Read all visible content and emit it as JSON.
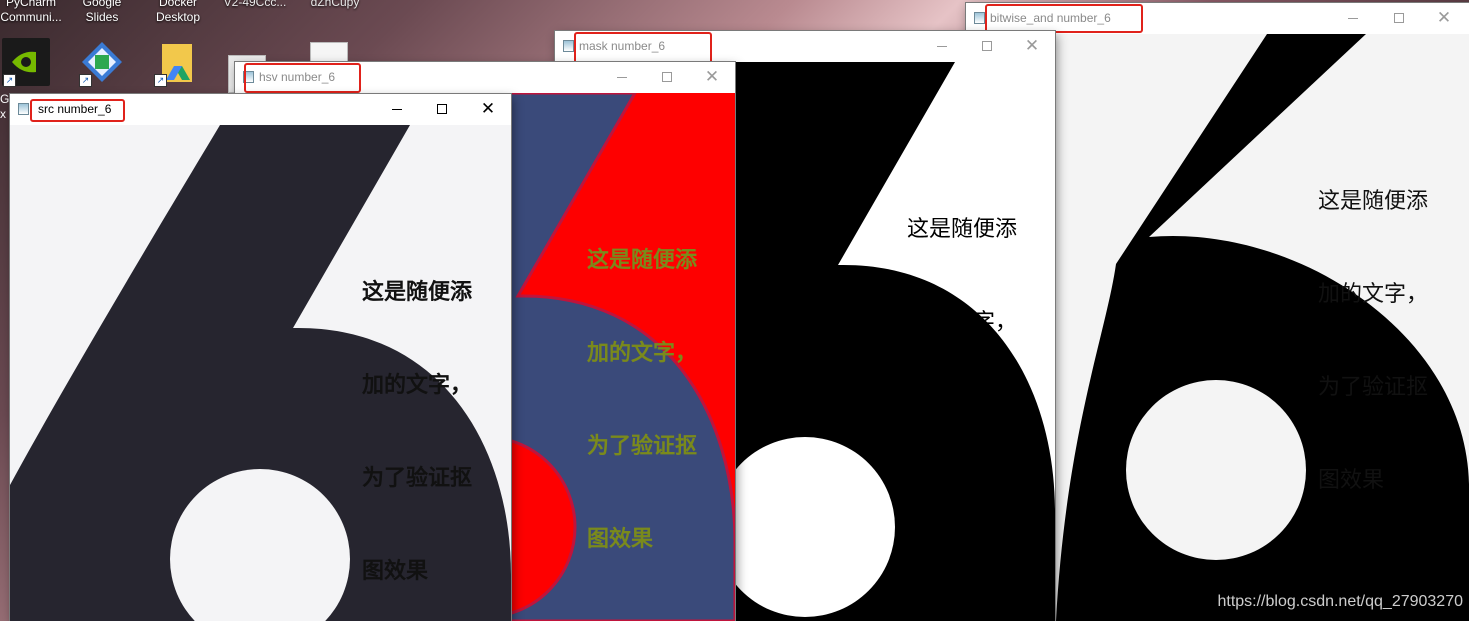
{
  "desktop": {
    "top_labels": [
      "PyCharm\nCommuni...",
      "Google\nSlides",
      "Docker\nDesktop",
      "V2-49Ccc..",
      "dZhCupy"
    ],
    "icons": [
      {
        "name": "nvidia-icon",
        "label": "G\nx"
      },
      {
        "name": "settings-app-icon",
        "label": ""
      },
      {
        "name": "google-drive-icon",
        "label": ""
      }
    ]
  },
  "windows": {
    "bitwise": {
      "title": "bitwise_and number_6"
    },
    "mask": {
      "title": "mask number_6"
    },
    "hsv": {
      "title": "hsv number_6"
    },
    "src": {
      "title": "src number_6"
    }
  },
  "caption_buttons": {
    "minimize": "",
    "maximize": "",
    "close": "✕"
  },
  "image_text": {
    "line1": "这是随便添",
    "line2": "加的文字，",
    "line3": "为了验证抠",
    "line4": "图效果"
  },
  "colors": {
    "src_bg": "#f4f4f6",
    "src_fg": "#26252f",
    "hsv_bg": "#fe0000",
    "hsv_fg": "#3a4a7a",
    "hsv_text": "#7a8a1c",
    "mask_fg": "#000000",
    "bitwise_bg": "#f4f4f4",
    "highlight_box": "#e0221b"
  },
  "watermark": "https://blog.csdn.net/qq_27903270"
}
